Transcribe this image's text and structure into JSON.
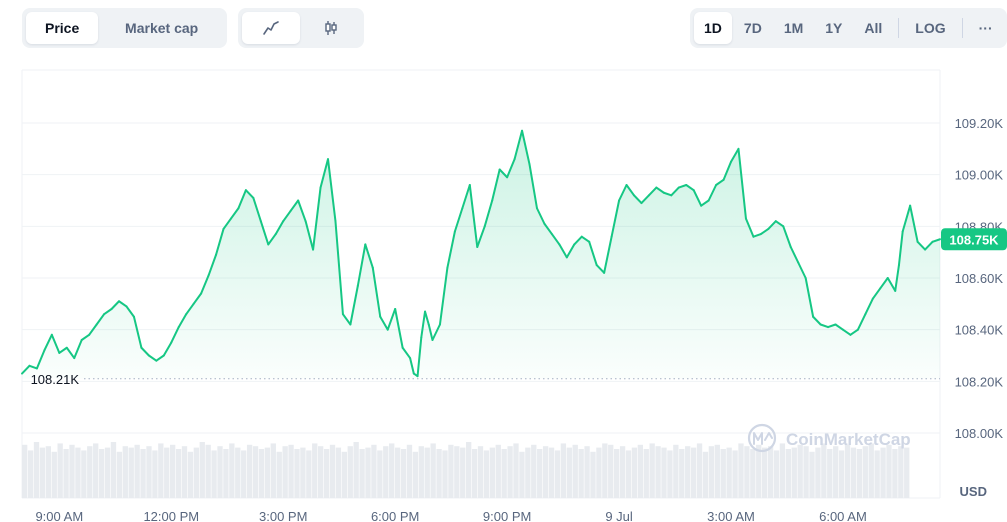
{
  "toolbar": {
    "metric_tabs": [
      "Price",
      "Market cap"
    ],
    "active_metric": "Price",
    "chart_types": [
      "line-chart-icon",
      "candlestick-icon"
    ],
    "active_chart_type": "line-chart-icon",
    "ranges": [
      "1D",
      "7D",
      "1M",
      "1Y",
      "All"
    ],
    "active_range": "1D",
    "log_label": "LOG",
    "more_label": "···"
  },
  "colors": {
    "up": "#16c784",
    "down": "#ea3943",
    "grid": "#eff2f5",
    "axis_text": "#58667e",
    "volume": "#e8ebef"
  },
  "watermark": "CoinMarketCap",
  "chart_data": {
    "type": "area",
    "currency_label": "USD",
    "current_price_label": "108.75K",
    "current_price": 108750,
    "open_price_label": "108.21K",
    "open_price": 108210,
    "ylim": [
      107900,
      109300
    ],
    "y_ticks": [
      108000,
      108200,
      108400,
      108600,
      108800,
      109000,
      109200
    ],
    "y_tick_labels": [
      "108.00K",
      "108.20K",
      "108.40K",
      "108.60K",
      "108.80K",
      "109.00K",
      "109.20K"
    ],
    "x_tick_labels": [
      "9:00 AM",
      "12:00 PM",
      "3:00 PM",
      "6:00 PM",
      "9:00 PM",
      "9 Jul",
      "3:00 AM",
      "6:00 AM"
    ],
    "x_tick_hours": [
      1,
      4,
      7,
      10,
      13,
      16,
      19,
      22
    ],
    "x_range_hours": [
      0,
      24.6
    ],
    "grid": true,
    "series": [
      {
        "values": [
          [
            0.0,
            108230
          ],
          [
            0.2,
            108260
          ],
          [
            0.4,
            108250
          ],
          [
            0.6,
            108320
          ],
          [
            0.8,
            108380
          ],
          [
            1.0,
            108310
          ],
          [
            1.2,
            108330
          ],
          [
            1.4,
            108290
          ],
          [
            1.6,
            108360
          ],
          [
            1.8,
            108380
          ],
          [
            2.0,
            108420
          ],
          [
            2.2,
            108460
          ],
          [
            2.4,
            108480
          ],
          [
            2.6,
            108510
          ],
          [
            2.8,
            108490
          ],
          [
            3.0,
            108450
          ],
          [
            3.2,
            108330
          ],
          [
            3.4,
            108300
          ],
          [
            3.6,
            108280
          ],
          [
            3.8,
            108300
          ],
          [
            4.0,
            108350
          ],
          [
            4.2,
            108410
          ],
          [
            4.4,
            108460
          ],
          [
            4.6,
            108500
          ],
          [
            4.8,
            108540
          ],
          [
            5.0,
            108610
          ],
          [
            5.2,
            108690
          ],
          [
            5.4,
            108790
          ],
          [
            5.6,
            108830
          ],
          [
            5.8,
            108870
          ],
          [
            6.0,
            108940
          ],
          [
            6.2,
            108910
          ],
          [
            6.4,
            108820
          ],
          [
            6.6,
            108730
          ],
          [
            6.8,
            108770
          ],
          [
            7.0,
            108820
          ],
          [
            7.2,
            108860
          ],
          [
            7.4,
            108900
          ],
          [
            7.6,
            108820
          ],
          [
            7.8,
            108710
          ],
          [
            8.0,
            108950
          ],
          [
            8.2,
            109060
          ],
          [
            8.4,
            108820
          ],
          [
            8.6,
            108460
          ],
          [
            8.8,
            108420
          ],
          [
            9.0,
            108570
          ],
          [
            9.2,
            108730
          ],
          [
            9.4,
            108640
          ],
          [
            9.6,
            108450
          ],
          [
            9.8,
            108400
          ],
          [
            10.0,
            108480
          ],
          [
            10.2,
            108330
          ],
          [
            10.4,
            108290
          ],
          [
            10.5,
            108230
          ],
          [
            10.6,
            108220
          ],
          [
            10.7,
            108370
          ],
          [
            10.8,
            108470
          ],
          [
            10.9,
            108420
          ],
          [
            11.0,
            108360
          ],
          [
            11.2,
            108420
          ],
          [
            11.4,
            108640
          ],
          [
            11.6,
            108780
          ],
          [
            11.8,
            108870
          ],
          [
            12.0,
            108960
          ],
          [
            12.2,
            108720
          ],
          [
            12.4,
            108800
          ],
          [
            12.6,
            108900
          ],
          [
            12.8,
            109020
          ],
          [
            13.0,
            108990
          ],
          [
            13.2,
            109060
          ],
          [
            13.4,
            109170
          ],
          [
            13.6,
            109040
          ],
          [
            13.8,
            108870
          ],
          [
            14.0,
            108810
          ],
          [
            14.2,
            108770
          ],
          [
            14.4,
            108730
          ],
          [
            14.6,
            108680
          ],
          [
            14.8,
            108730
          ],
          [
            15.0,
            108760
          ],
          [
            15.2,
            108740
          ],
          [
            15.4,
            108650
          ],
          [
            15.6,
            108620
          ],
          [
            15.8,
            108760
          ],
          [
            16.0,
            108900
          ],
          [
            16.2,
            108960
          ],
          [
            16.4,
            108920
          ],
          [
            16.6,
            108890
          ],
          [
            16.8,
            108920
          ],
          [
            17.0,
            108950
          ],
          [
            17.2,
            108930
          ],
          [
            17.4,
            108920
          ],
          [
            17.6,
            108950
          ],
          [
            17.8,
            108960
          ],
          [
            18.0,
            108940
          ],
          [
            18.2,
            108880
          ],
          [
            18.4,
            108900
          ],
          [
            18.6,
            108960
          ],
          [
            18.8,
            108980
          ],
          [
            19.0,
            109050
          ],
          [
            19.2,
            109100
          ],
          [
            19.4,
            108830
          ],
          [
            19.6,
            108760
          ],
          [
            19.8,
            108770
          ],
          [
            20.0,
            108790
          ],
          [
            20.2,
            108820
          ],
          [
            20.4,
            108800
          ],
          [
            20.6,
            108720
          ],
          [
            20.8,
            108660
          ],
          [
            21.0,
            108600
          ],
          [
            21.2,
            108450
          ],
          [
            21.4,
            108420
          ],
          [
            21.6,
            108410
          ],
          [
            21.8,
            108420
          ],
          [
            22.0,
            108400
          ],
          [
            22.2,
            108380
          ],
          [
            22.4,
            108400
          ],
          [
            22.6,
            108460
          ],
          [
            22.8,
            108520
          ],
          [
            23.0,
            108560
          ],
          [
            23.2,
            108600
          ],
          [
            23.4,
            108550
          ],
          [
            23.5,
            108650
          ],
          [
            23.6,
            108780
          ],
          [
            23.8,
            108880
          ],
          [
            24.0,
            108740
          ],
          [
            24.2,
            108710
          ],
          [
            24.4,
            108740
          ],
          [
            24.6,
            108750
          ]
        ]
      }
    ],
    "volume": [
      38,
      34,
      40,
      36,
      37,
      33,
      39,
      35,
      38,
      36,
      34,
      37,
      39,
      35,
      36,
      40,
      33,
      37,
      36,
      38,
      35,
      37,
      34,
      39,
      36,
      38,
      35,
      37,
      33,
      36,
      40,
      38,
      34,
      37,
      35,
      39,
      36,
      34,
      38,
      37,
      35,
      36,
      39,
      33,
      37,
      38,
      35,
      36,
      34,
      39,
      37,
      35,
      38,
      36,
      33,
      37,
      40,
      35,
      36,
      38,
      34,
      37,
      39,
      36,
      35,
      38,
      33,
      37,
      36,
      39,
      35,
      34,
      38,
      37,
      36,
      40,
      35,
      37,
      34,
      36,
      38,
      35,
      37,
      39,
      33,
      36,
      38,
      35,
      37,
      36,
      34,
      39,
      36,
      38,
      35,
      37,
      33,
      36,
      39,
      38,
      35,
      37,
      34,
      36,
      38,
      35,
      39,
      37,
      36,
      34,
      38,
      35,
      37,
      36,
      39,
      33,
      37,
      38,
      35,
      36,
      34,
      39,
      37,
      35,
      38,
      36,
      37,
      34,
      39,
      35,
      36,
      38,
      37,
      33,
      36,
      39,
      35,
      37,
      34,
      38,
      36,
      35,
      37,
      39,
      34,
      36,
      38,
      35,
      37,
      36
    ]
  }
}
